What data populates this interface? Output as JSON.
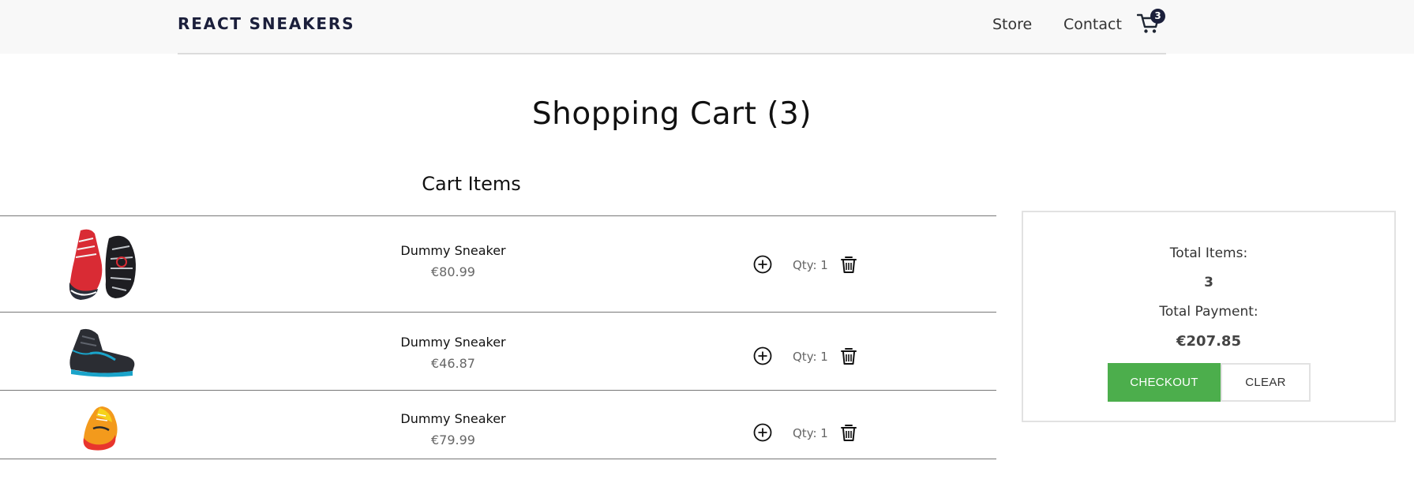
{
  "navbar": {
    "brand": "REACT SNEAKERS",
    "links": [
      "Store",
      "Contact"
    ],
    "cart_count": "3",
    "cart_icon": "cart-icon"
  },
  "page": {
    "title": "Shopping Cart (3)",
    "section_title": "Cart Items"
  },
  "cart": {
    "items": [
      {
        "name": "Dummy Sneaker",
        "price": "€80.99",
        "qty": "Qty: 1",
        "image": "red sneaker pair"
      },
      {
        "name": "Dummy Sneaker",
        "price": "€46.87",
        "qty": "Qty: 1",
        "image": "black and blue high-top sneaker"
      },
      {
        "name": "Dummy Sneaker",
        "price": "€79.99",
        "qty": "Qty: 1",
        "image": "orange and yellow sneaker"
      }
    ]
  },
  "summary": {
    "total_items_label": "Total Items:",
    "total_items_value": "3",
    "total_payment_label": "Total Payment:",
    "total_payment_value": "€207.85",
    "checkout_label": "CHECKOUT",
    "clear_label": "CLEAR"
  },
  "colors": {
    "navbar_bg": "#f8f8f8",
    "brand_text": "#1b1f3b",
    "checkout_green": "#4cae4c",
    "divider": "#777777"
  }
}
